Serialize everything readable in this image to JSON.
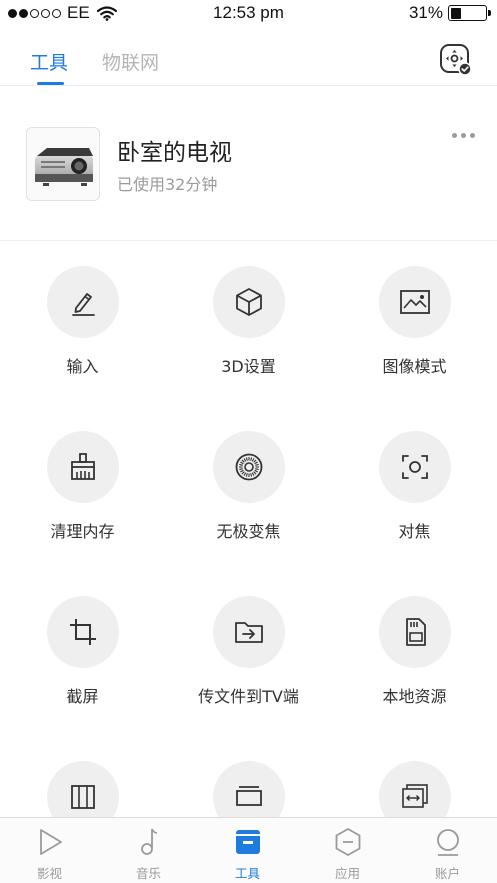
{
  "status_bar": {
    "carrier": "EE",
    "time": "12:53 pm",
    "battery": "31%",
    "battery_level": 0.31,
    "signal_bars": 2,
    "icons": [
      "signal-dots-icon",
      "wifi-icon",
      "battery-icon"
    ]
  },
  "top_tabs": {
    "items": [
      {
        "label": "工具",
        "active": true
      },
      {
        "label": "物联网",
        "active": false
      }
    ],
    "remote_icon": "remote-control-icon",
    "accent_color": "#1e7ce0"
  },
  "device": {
    "name": "卧室的电视",
    "usage": "已使用32分钟",
    "thumbnail_icon": "projector-icon",
    "menu_icon": "more-dots-icon"
  },
  "tools": [
    {
      "label": "输入",
      "icon": "pencil-icon"
    },
    {
      "label": "3D设置",
      "icon": "cube-icon"
    },
    {
      "label": "图像模式",
      "icon": "picture-icon"
    },
    {
      "label": "清理内存",
      "icon": "broom-icon"
    },
    {
      "label": "无极变焦",
      "icon": "zoom-dial-icon"
    },
    {
      "label": "对焦",
      "icon": "focus-icon"
    },
    {
      "label": "截屏",
      "icon": "crop-icon"
    },
    {
      "label": "传文件到TV端",
      "icon": "folder-transfer-icon"
    },
    {
      "label": "本地资源",
      "icon": "sd-card-icon"
    },
    {
      "label": "",
      "icon": "keystone-icon"
    },
    {
      "label": "",
      "icon": "screen-icon"
    },
    {
      "label": "",
      "icon": "aspect-ratio-icon"
    }
  ],
  "bottom_nav": {
    "items": [
      {
        "label": "影视",
        "icon": "play-icon",
        "active": false
      },
      {
        "label": "音乐",
        "icon": "music-note-icon",
        "active": false
      },
      {
        "label": "工具",
        "icon": "toolbox-icon",
        "active": true
      },
      {
        "label": "应用",
        "icon": "apps-hexagon-icon",
        "active": false
      },
      {
        "label": "账户",
        "icon": "user-icon",
        "active": false
      }
    ]
  }
}
